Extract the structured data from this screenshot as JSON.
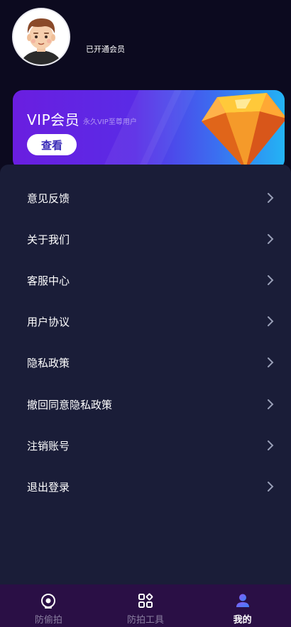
{
  "profile": {
    "member_status": "已开通会员"
  },
  "vip_card": {
    "title": "VIP会员",
    "subtitle": "永久VIP至尊用户",
    "button_label": "查看"
  },
  "menu": {
    "items": [
      {
        "label": "意见反馈"
      },
      {
        "label": "关于我们"
      },
      {
        "label": "客服中心"
      },
      {
        "label": "用户协议"
      },
      {
        "label": "隐私政策"
      },
      {
        "label": "撤回同意隐私政策"
      },
      {
        "label": "注销账号"
      },
      {
        "label": "退出登录"
      }
    ]
  },
  "bottom_nav": {
    "items": [
      {
        "label": "防偷拍",
        "icon": "camera-lens-icon",
        "active": false
      },
      {
        "label": "防拍工具",
        "icon": "tools-grid-icon",
        "active": false
      },
      {
        "label": "我的",
        "icon": "user-profile-icon",
        "active": true
      }
    ]
  },
  "colors": {
    "background": "#0c0a1f",
    "panel": "#1a1d38",
    "nav_bg": "#2a0f45",
    "accent": "#6a1ee0"
  }
}
